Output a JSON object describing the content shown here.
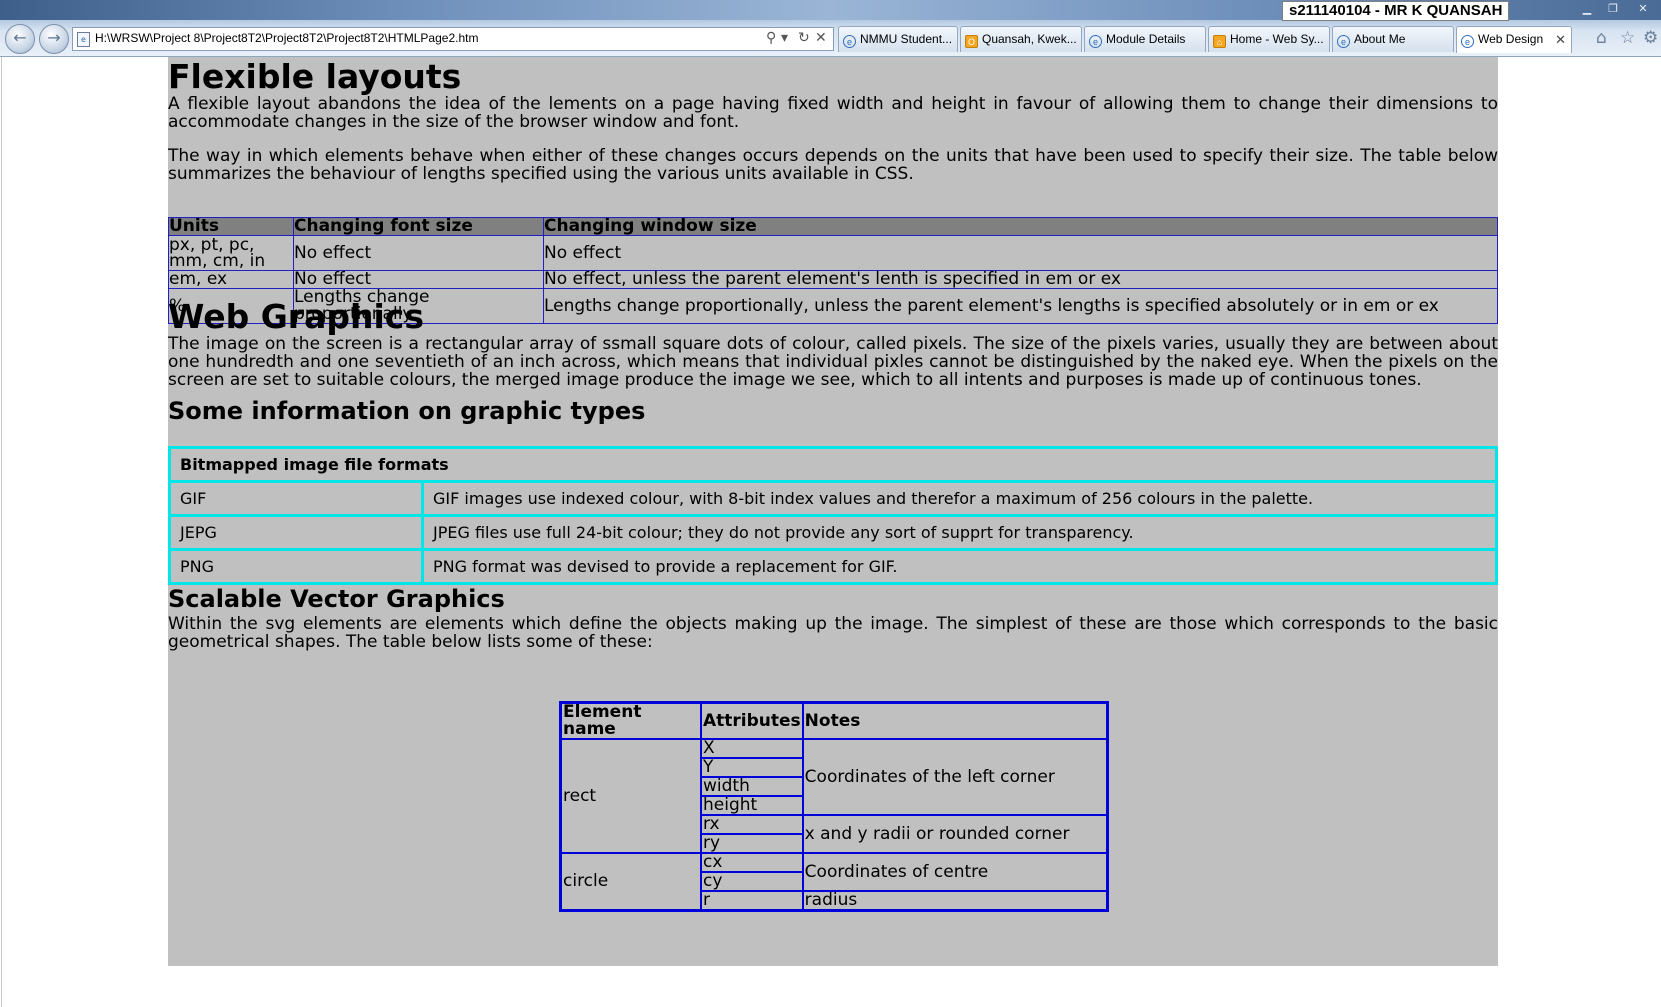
{
  "browser": {
    "address": "H:\\WRSW\\Project 8\\Project8T2\\Project8T2\\Project8T2\\HTMLPage2.htm",
    "user_badge": "s211140104 - MR K QUANSAH",
    "tabs": [
      {
        "label": "NMMU Student...",
        "icon": "ie-icon"
      },
      {
        "label": "Quansah, Kwek...",
        "icon": "outlook-icon"
      },
      {
        "label": "Module Details",
        "icon": "ie-icon"
      },
      {
        "label": "Home - Web Sy...",
        "icon": "home-icon"
      },
      {
        "label": "About Me",
        "icon": "ie-icon"
      },
      {
        "label": "Web Design",
        "icon": "ie-icon",
        "active": true
      }
    ]
  },
  "page": {
    "h_flexible": "Flexible layouts",
    "p_flexible_1": "A flexible layout abandons the idea of the lements on a page having fixed width and height in favour of allowing them to change their dimensions to accommodate changes in the size of the browser window and font.",
    "p_flexible_2": "The way in which elements behave when either of these changes occurs depends on the units that have been used to specify their size. The table below summarizes the behaviour of lengths specified using the various units available in CSS.",
    "units_table": {
      "headers": [
        "Units",
        "Changing font size",
        "Changing window size"
      ],
      "rows": [
        [
          "px, pt, pc, mm, cm, in",
          "No effect",
          "No effect"
        ],
        [
          "em, ex",
          "No effect",
          "No effect, unless the parent element's lenth is specified in em or ex"
        ],
        [
          "%",
          "Lengths change proportionally",
          "Lengths change proportionally, unless the parent element's lengths is specified absolutely or in em or ex"
        ]
      ]
    },
    "h_web_graphics": "Web Graphics",
    "p_web_graphics": "The image on the screen is a rectangular array of ssmall square dots of colour, called pixels. The size of the pixels varies, usually they are between about one hundredth and one seventieth of an inch across, which means that individual pixles cannot be distinguished by the naked eye. When the pixels on the screen are set to suitable colours, the merged image produce the image we see, which to all intents and purposes is made up of continuous tones.",
    "h_graphic_types": "Some information on graphic types",
    "formats_table": {
      "caption": "Bitmapped image file formats",
      "rows": [
        [
          "GIF",
          "GIF images use indexed colour, with 8-bit index values and therefor a maximum of 256 colours in the palette."
        ],
        [
          "JEPG",
          "JPEG files use full 24-bit colour; they do not provide any sort of supprt for transparency."
        ],
        [
          "PNG",
          "PNG format was devised to provide a replacement for GIF."
        ]
      ]
    },
    "h_svg": "Scalable Vector Graphics",
    "p_svg": "Within the svg elements are elements which define the objects making up the image. The simplest of these are those which corresponds to the basic geometrical shapes. The table below lists some of these:",
    "svg_table": {
      "headers": [
        "Element name",
        "Attributes",
        "Notes"
      ],
      "rect": "rect",
      "circle": "circle",
      "attrs": [
        "X",
        "Y",
        "width",
        "height",
        "rx",
        "ry",
        "cx",
        "cy",
        "r"
      ],
      "notes": [
        "Coordinates of the left corner",
        "x and y radii or rounded corner",
        "Coordinates of centre",
        "radius"
      ]
    }
  },
  "colors": {
    "content_bg": "#c0c0c0",
    "units_header_bg": "#808080",
    "units_border": "#2020c0",
    "formats_border": "#00e5e5",
    "svg_border": "#0000d8"
  }
}
